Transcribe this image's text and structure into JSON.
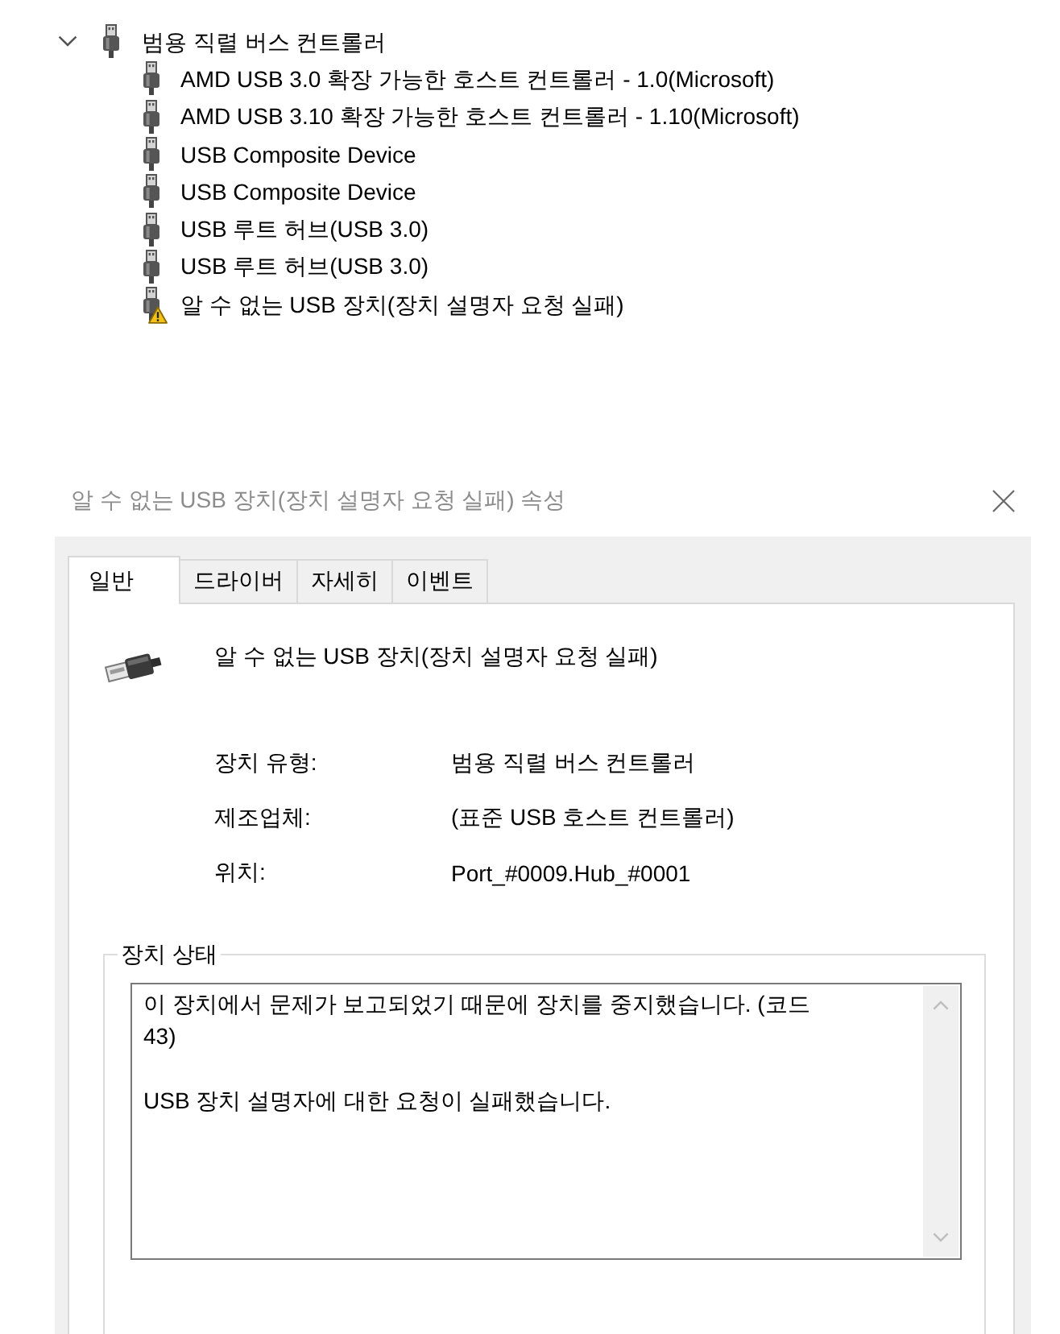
{
  "device_tree": [
    {
      "label": "범용 직렬 버스 컨트롤러",
      "expanded": true,
      "children": [
        {
          "label": "AMD USB 3.0 확장 가능한 호스트 컨트롤러 - 1.0(Microsoft)",
          "warning": false
        },
        {
          "label": "AMD USB 3.10 확장 가능한 호스트 컨트롤러 - 1.10(Microsoft)",
          "warning": false
        },
        {
          "label": "USB Composite Device",
          "warning": false
        },
        {
          "label": "USB Composite Device",
          "warning": false
        },
        {
          "label": "USB 루트 허브(USB 3.0)",
          "warning": false
        },
        {
          "label": "USB 루트 허브(USB 3.0)",
          "warning": false
        },
        {
          "label": "알 수 없는 USB 장치(장치 설명자 요청 실패)",
          "warning": true
        }
      ]
    }
  ],
  "properties_dialog": {
    "title": "알 수 없는 USB 장치(장치 설명자 요청 실패) 속성",
    "tabs": [
      {
        "label": "일반",
        "selected": true
      },
      {
        "label": "드라이버",
        "selected": false
      },
      {
        "label": "자세히",
        "selected": false
      },
      {
        "label": "이벤트",
        "selected": false
      }
    ],
    "device_name": "알 수 없는 USB 장치(장치 설명자 요청 실패)",
    "properties": [
      {
        "label": "장치 유형:",
        "value": "범용 직렬 버스 컨트롤러"
      },
      {
        "label": "제조업체:",
        "value": "(표준 USB 호스트 컨트롤러)"
      },
      {
        "label": "위치:",
        "value": "Port_#0009.Hub_#0001"
      }
    ],
    "status_group": {
      "title": "장치 상태",
      "paragraphs": [
        {
          "lines": [
            "이 장치에서 문제가 보고되었기 때문에 장치를 중지했습니다. (코드",
            "43)"
          ]
        },
        {
          "lines": [
            "USB 장치 설명자에 대한 요청이 실패했습니다."
          ]
        }
      ]
    }
  }
}
